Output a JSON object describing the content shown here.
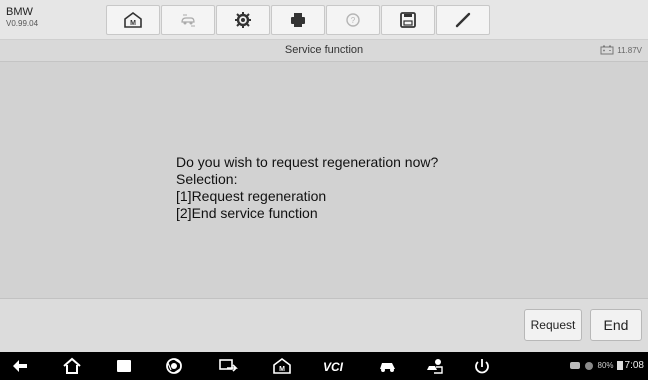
{
  "header": {
    "brand": "BMW",
    "version": "V0.99.04",
    "toolbar_icons": [
      "home-icon",
      "vehicle-swap-icon",
      "settings-icon",
      "print-icon",
      "help-icon",
      "save-icon",
      "edit-icon"
    ]
  },
  "titlebar": {
    "title": "Service function",
    "voltage": "11.87V"
  },
  "message": {
    "lines": [
      "Do you wish to request regeneration now?",
      "Selection:",
      "[1]Request regeneration",
      "[2]End service function"
    ]
  },
  "actions": {
    "request_label": "Request",
    "end_label": "End"
  },
  "navbar": {
    "icons": [
      "back-icon",
      "home-icon",
      "recent-apps-icon",
      "browser-icon",
      "remote-icon",
      "maxifix-icon",
      "vci-icon",
      "vehicle-icon",
      "tech-support-icon",
      "power-icon"
    ],
    "vci_label": "VCI",
    "battery": "80%",
    "time": "7:08"
  },
  "colors": {
    "content_bg": "#d2d2d2",
    "navbar_bg": "#000000",
    "toolbar_bg": "#e6e6e6"
  }
}
